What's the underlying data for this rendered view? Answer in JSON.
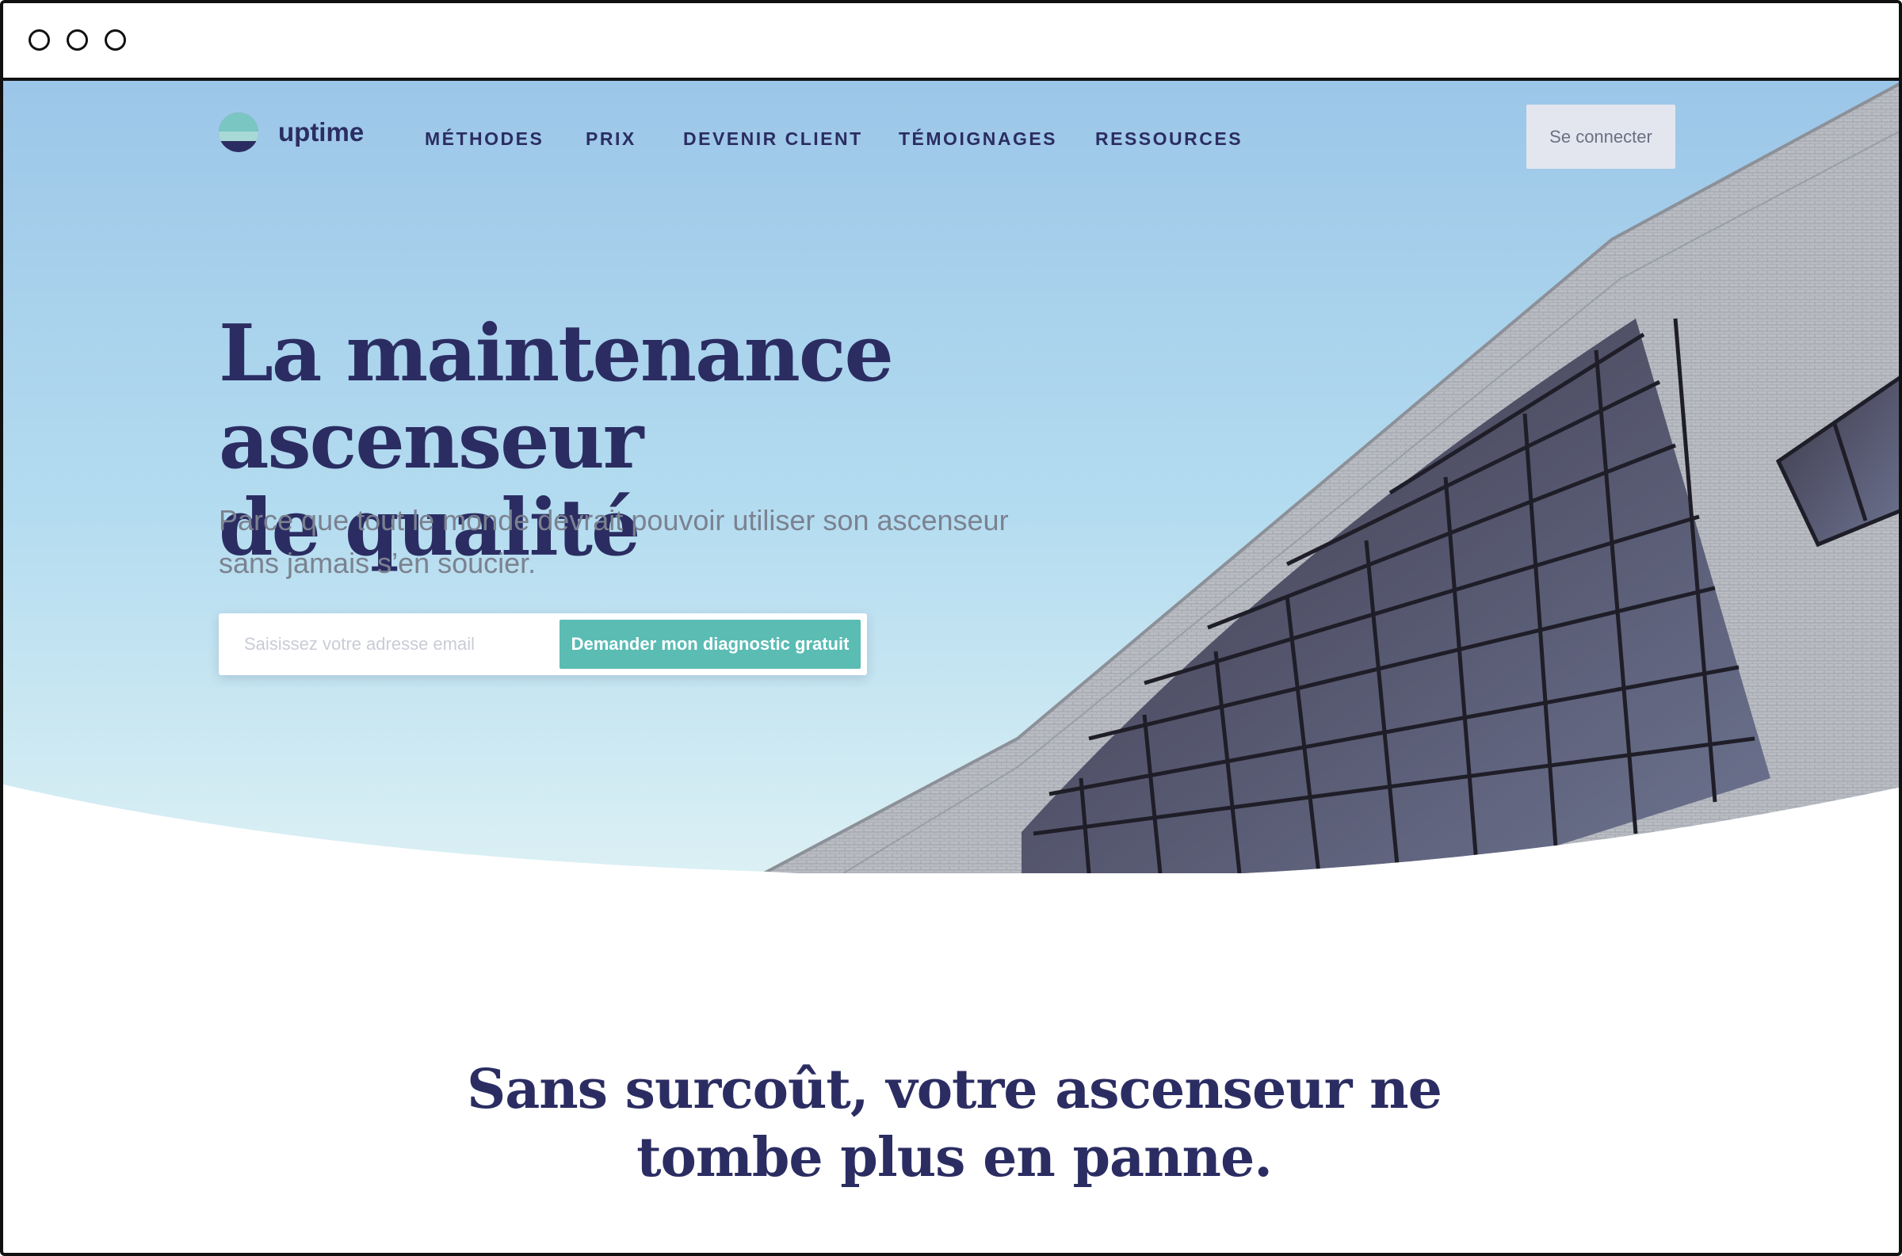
{
  "nav": {
    "logo_text": "uptime",
    "items": [
      {
        "label": "MÉTHODES"
      },
      {
        "label": "PRIX"
      },
      {
        "label": "DEVENIR CLIENT"
      },
      {
        "label": "TÉMOIGNAGES"
      },
      {
        "label": "RESSOURCES"
      }
    ],
    "login_label": "Se connecter"
  },
  "hero": {
    "title_line1": "La maintenance ascenseur",
    "title_line2": "de qualité",
    "subtitle_line1": "Parce que tout le monde devrait pouvoir utiliser son ascenseur",
    "subtitle_line2": "sans jamais s’en soucier.",
    "email_placeholder": "Saisissez votre adresse email",
    "cta_label": "Demander mon diagnostic gratuit"
  },
  "section": {
    "heading_line1": "Sans surcoût, votre ascenseur ne",
    "heading_line2": "tombe plus en panne."
  },
  "colors": {
    "brand_navy": "#2b2d62",
    "accent_teal": "#5bbcb4",
    "sky_top": "#9fc8e8",
    "sky_bottom": "#d8eff4"
  }
}
